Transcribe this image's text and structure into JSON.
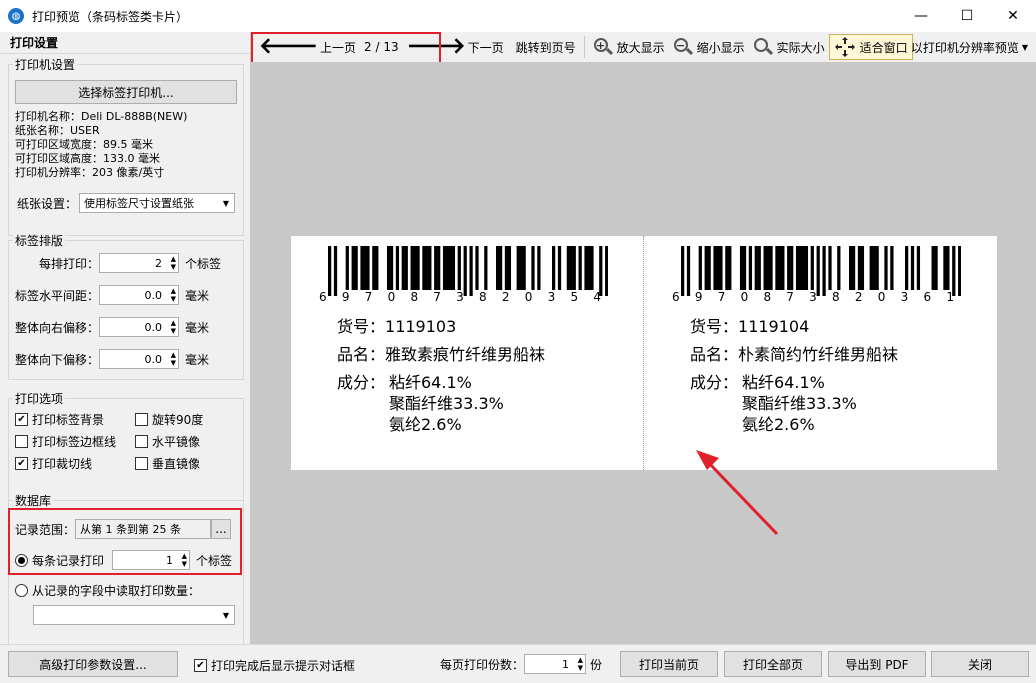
{
  "window": {
    "title": "打印预览（条码标签类卡片）",
    "minimize": "—",
    "maximize": "☐",
    "close": "✕"
  },
  "left": {
    "header": "打印设置",
    "printer_group": {
      "title": "打印机设置",
      "select_button": "选择标签打印机...",
      "info": [
        "打印机名称：Deli DL-888B(NEW)",
        "纸张名称：USER",
        "可打印区域宽度：89.5 毫米",
        "可打印区域高度：133.0 毫米",
        "打印机分辨率：203 像素/英寸"
      ],
      "paper_label": "纸张设置：",
      "paper_value": "使用标签尺寸设置纸张"
    },
    "layout_group": {
      "title": "标签排版",
      "rows": [
        {
          "label": "每排打印：",
          "value": "2",
          "unit": "个标签"
        },
        {
          "label": "标签水平间距：",
          "value": "0.0",
          "unit": "毫米"
        },
        {
          "label": "整体向右偏移：",
          "value": "0.0",
          "unit": "毫米"
        },
        {
          "label": "整体向下偏移：",
          "value": "0.0",
          "unit": "毫米"
        }
      ]
    },
    "options_group": {
      "title": "打印选项",
      "checks": [
        {
          "label": "打印标签背景",
          "checked": true
        },
        {
          "label": "旋转90度",
          "checked": false
        },
        {
          "label": "打印标签边框线",
          "checked": false
        },
        {
          "label": "水平镜像",
          "checked": false
        },
        {
          "label": "打印裁切线",
          "checked": true
        },
        {
          "label": "垂直镜像",
          "checked": false
        }
      ]
    },
    "db_group": {
      "title": "数据库",
      "range_label": "记录范围：",
      "range_value": "从第 1 条到第 25 条",
      "range_btn": "...",
      "per_record_label": "每条记录打印",
      "per_record_value": "1",
      "per_record_unit": "个标签",
      "from_field_label": "从记录的字段中读取打印数量："
    }
  },
  "toolbar": {
    "prev": "上一页",
    "page": "2 / 13",
    "next": "下一页",
    "jump": "跳转到页号",
    "zoom_in": "放大显示",
    "zoom_out": "缩小显示",
    "actual": "实际大小",
    "fit": "适合窗口",
    "resolution": "以打印机分辨率预览"
  },
  "labels": [
    {
      "barcode_digits": [
        "6",
        "9",
        "7",
        "0",
        "8",
        "7",
        "3",
        "8",
        "2",
        "0",
        "3",
        "5",
        "4"
      ],
      "item_no_label": "货号：",
      "item_no": "1119103",
      "name_label": "品名：",
      "name": "雅致素痕竹纤维男船袜",
      "comp_label": "成分：",
      "comp": [
        "粘纤64.1%",
        "聚酯纤维33.3%",
        "氨纶2.6%"
      ]
    },
    {
      "barcode_digits": [
        "6",
        "9",
        "7",
        "0",
        "8",
        "7",
        "3",
        "8",
        "2",
        "0",
        "3",
        "6",
        "1"
      ],
      "item_no_label": "货号：",
      "item_no": "1119104",
      "name_label": "品名：",
      "name": "朴素简约竹纤维男船袜",
      "comp_label": "成分：",
      "comp": [
        "粘纤64.1%",
        "聚酯纤维33.3%",
        "氨纶2.6%"
      ]
    }
  ],
  "bottom": {
    "advanced": "高级打印参数设置...",
    "show_dialog": "打印完成后显示提示对话框",
    "copies_label": "每页打印份数：",
    "copies_value": "1",
    "copies_unit": "份",
    "print_current": "打印当前页",
    "print_all": "打印全部页",
    "export_pdf": "导出到 PDF",
    "close": "关闭"
  },
  "colors": {
    "highlight_box": "#e0202a",
    "arrow": "#e0202a",
    "fit_button_bg": "#fff7d6"
  }
}
